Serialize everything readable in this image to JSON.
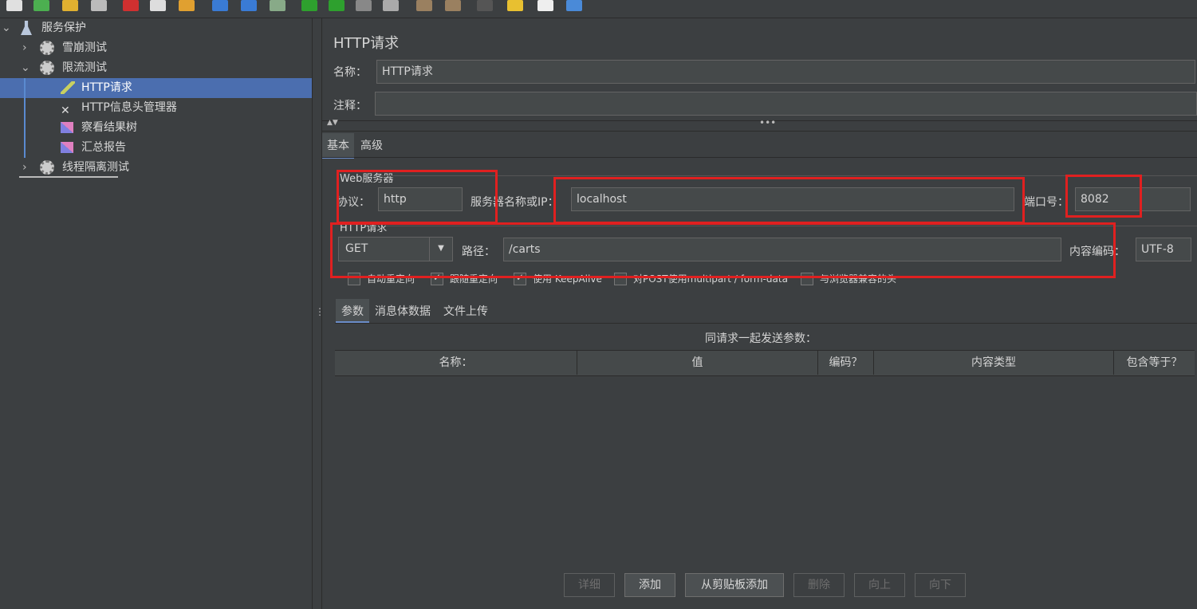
{
  "tree": {
    "root_label": "服务保护",
    "nodes": [
      {
        "label": "雪崩测试"
      },
      {
        "label": "限流测试"
      },
      {
        "label": "HTTP请求"
      },
      {
        "label": "HTTP信息头管理器"
      },
      {
        "label": "察看结果树"
      },
      {
        "label": "汇总报告"
      },
      {
        "label": "线程隔离测试"
      }
    ]
  },
  "panel": {
    "title": "HTTP请求",
    "name_label": "名称：",
    "name_value": "HTTP请求",
    "comment_label": "注释：",
    "comment_value": ""
  },
  "tabs": {
    "basic": "基本",
    "advanced": "高级"
  },
  "web_server": {
    "section_label": "Web服务器",
    "protocol_label": "协议：",
    "protocol_value": "http",
    "server_label": "服务器名称或IP：",
    "server_value": "localhost",
    "port_label": "端口号：",
    "port_value": "8082"
  },
  "http_request": {
    "section_label": "HTTP请求",
    "method_value": "GET",
    "path_label": "路径：",
    "path_value": "/carts",
    "encoding_label": "内容编码：",
    "encoding_value": "UTF-8"
  },
  "checkboxes": [
    {
      "label": "自动重定向",
      "checked": false
    },
    {
      "label": "跟随重定向",
      "checked": true
    },
    {
      "label": "使用 KeepAlive",
      "checked": true
    },
    {
      "label": "对POST使用multipart / form-data",
      "checked": false
    },
    {
      "label": "与浏览器兼容的头",
      "checked": false
    }
  ],
  "sub_tabs": {
    "params": "参数",
    "body": "消息体数据",
    "files": "文件上传"
  },
  "params": {
    "caption": "同请求一起发送参数：",
    "columns": [
      "名称：",
      "值",
      "编码？",
      "内容类型",
      "包含等于？"
    ]
  },
  "buttons": {
    "detail": "详细",
    "add": "添加",
    "add_clipboard": "从剪贴板添加",
    "delete": "删除",
    "up": "向上",
    "down": "向下"
  },
  "colors": {
    "accent": "#4b6eaf",
    "highlight": "#e02020"
  }
}
